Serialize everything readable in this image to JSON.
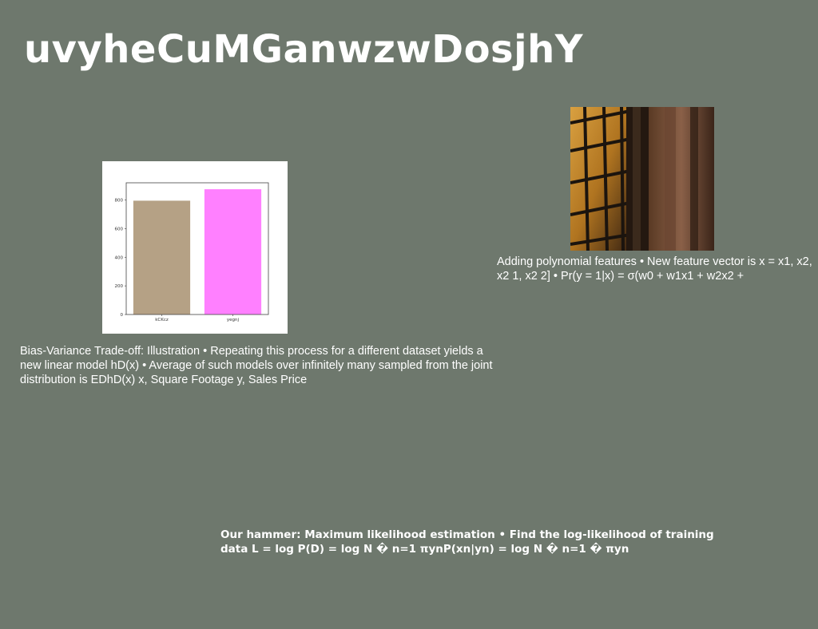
{
  "title": "uvyheCuMGanwzwDosjhY",
  "chart_data": {
    "type": "bar",
    "categories": [
      "kCKcz",
      "yegnj"
    ],
    "values": [
      795,
      875
    ],
    "colors": [
      "#b5a185",
      "#ff80ff"
    ],
    "yticks": [
      0,
      200,
      400,
      600,
      800
    ],
    "ylim": [
      0,
      920
    ],
    "title": "",
    "xlabel": "",
    "ylabel": ""
  },
  "captions": {
    "left": "Bias-Variance Trade-off: Illustration • Repeating this process for a different dataset yields a new linear model hD(x) • Average of such models over infinitely many sampled from the joint distribution is EDhD(x) x, Square Footage y, Sales Price",
    "right": "Adding polynomial features • New feature vector is x = x1, x2, x2 1, x2 2] • Pr(y = 1|x) = σ(w0 + w1x1 + w2x2 +",
    "bottom": "Our hammer: Maximum likelihood estimation • Find the log-likelihood of training data L = log P(D) = log N � n=1 πynP(xn|yn) = log N � n=1 � πyn"
  }
}
